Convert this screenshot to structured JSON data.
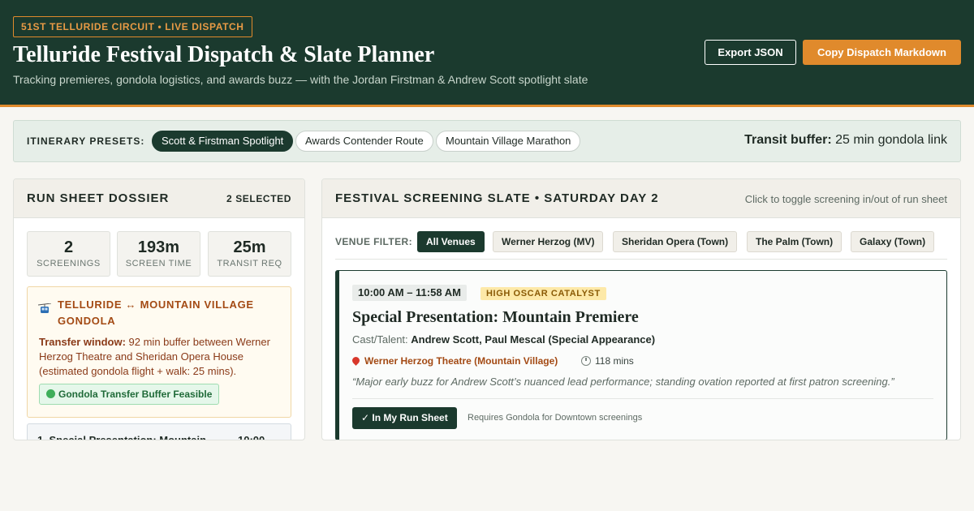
{
  "header": {
    "kicker": "51ST TELLURIDE CIRCUIT • LIVE DISPATCH",
    "title": "Telluride Festival Dispatch & Slate Planner",
    "subtitle": "Tracking premieres, gondola logistics, and awards buzz — with the Jordan Firstman & Andrew Scott spotlight slate",
    "export_label": "Export JSON",
    "copy_label": "Copy Dispatch Markdown"
  },
  "presets": {
    "label": "ITINERARY PRESETS:",
    "items": [
      {
        "label": "Scott & Firstman Spotlight",
        "active": true
      },
      {
        "label": "Awards Contender Route",
        "active": false
      },
      {
        "label": "Mountain Village Marathon",
        "active": false
      }
    ],
    "transit_label": "Transit buffer:",
    "transit_value": "25 min gondola link"
  },
  "run_sheet": {
    "title": "RUN SHEET DOSSIER",
    "selected": "2 SELECTED",
    "stats": [
      {
        "value": "2",
        "label": "SCREENINGS"
      },
      {
        "value": "193m",
        "label": "SCREEN TIME"
      },
      {
        "value": "25m",
        "label": "TRANSIT REQ"
      }
    ],
    "gondola": {
      "icon": "gondola-icon",
      "title": "TELLURIDE ↔ MOUNTAIN VILLAGE GONDOLA",
      "transfer_label": "Transfer window:",
      "transfer_text": "92 min buffer between Werner Herzog Theatre and Sheridan Opera House (estimated gondola flight + walk: 25 mins).",
      "feasible_label": "Gondola Transfer Buffer Feasible",
      "feasible_color": "#3fae5a"
    },
    "items": [
      {
        "label": "1. Special Presentation: Mountain",
        "time": "10:00"
      }
    ]
  },
  "slate": {
    "title": "FESTIVAL SCREENING SLATE • SATURDAY DAY 2",
    "hint": "Click to toggle screening in/out of run sheet",
    "venue_filter_label": "VENUE FILTER:",
    "venues": [
      {
        "label": "All Venues",
        "active": true
      },
      {
        "label": "Werner Herzog (MV)",
        "active": false
      },
      {
        "label": "Sheridan Opera (Town)",
        "active": false
      },
      {
        "label": "The Palm (Town)",
        "active": false
      },
      {
        "label": "Galaxy (Town)",
        "active": false
      }
    ],
    "card": {
      "time": "10:00 AM – 11:58 AM",
      "badge": "HIGH OSCAR CATALYST",
      "title": "Special Presentation: Mountain Premiere",
      "cast_label": "Cast/Talent:",
      "cast": "Andrew Scott, Paul Mescal (Special Appearance)",
      "venue": "Werner Herzog Theatre (Mountain Village)",
      "duration": "118 mins",
      "quote": "“Major early buzz for Andrew Scott’s nuanced lead performance; standing ovation reported at first patron screening.”",
      "in_sheet_label": "✓ In My Run Sheet",
      "requires": "Requires Gondola for Downtown screenings"
    }
  },
  "colors": {
    "brand_dark": "#1b3a2e",
    "accent": "#e08a2c"
  }
}
